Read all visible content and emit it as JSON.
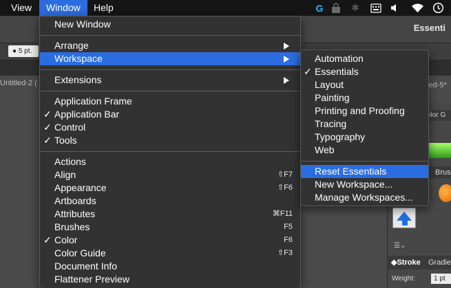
{
  "menubar": {
    "view": "View",
    "window": "Window",
    "help": "Help"
  },
  "app": {
    "workspace_name": "Essenti",
    "stroke_size": "●  5 pt.",
    "doc_tab_left": "Untitled-2 (",
    "doc_tab_right": "led-5*",
    "color_panel_tab": "olor G",
    "brushes_tab": "Brus",
    "stroke_tab": "Stroke",
    "gradient_tab": "Gradie",
    "weight_label": "Weight:",
    "weight_value": "1 pt"
  },
  "window_menu": {
    "new_window": "New Window",
    "arrange": "Arrange",
    "workspace": "Workspace",
    "extensions": "Extensions",
    "application_frame": "Application Frame",
    "application_bar": "Application Bar",
    "control": "Control",
    "tools": "Tools",
    "actions": "Actions",
    "align": "Align",
    "align_shortcut": "⇧F7",
    "appearance": "Appearance",
    "appearance_shortcut": "⇧F6",
    "artboards": "Artboards",
    "attributes": "Attributes",
    "attributes_shortcut": "⌘F11",
    "brushes": "Brushes",
    "brushes_shortcut": "F5",
    "color": "Color",
    "color_shortcut": "F6",
    "color_guide": "Color Guide",
    "color_guide_shortcut": "⇧F3",
    "document_info": "Document Info",
    "flattener_preview": "Flattener Preview"
  },
  "workspace_submenu": {
    "automation": "Automation",
    "essentials": "Essentials",
    "layout": "Layout",
    "painting": "Painting",
    "printing_and_proofing": "Printing and Proofing",
    "tracing": "Tracing",
    "typography": "Typography",
    "web": "Web",
    "reset_essentials": "Reset Essentials",
    "new_workspace": "New Workspace...",
    "manage_workspaces": "Manage Workspaces..."
  },
  "colors": {
    "menubar_bg": "#151515",
    "highlight": "#2b6de0",
    "menu_bg": "#323232"
  }
}
